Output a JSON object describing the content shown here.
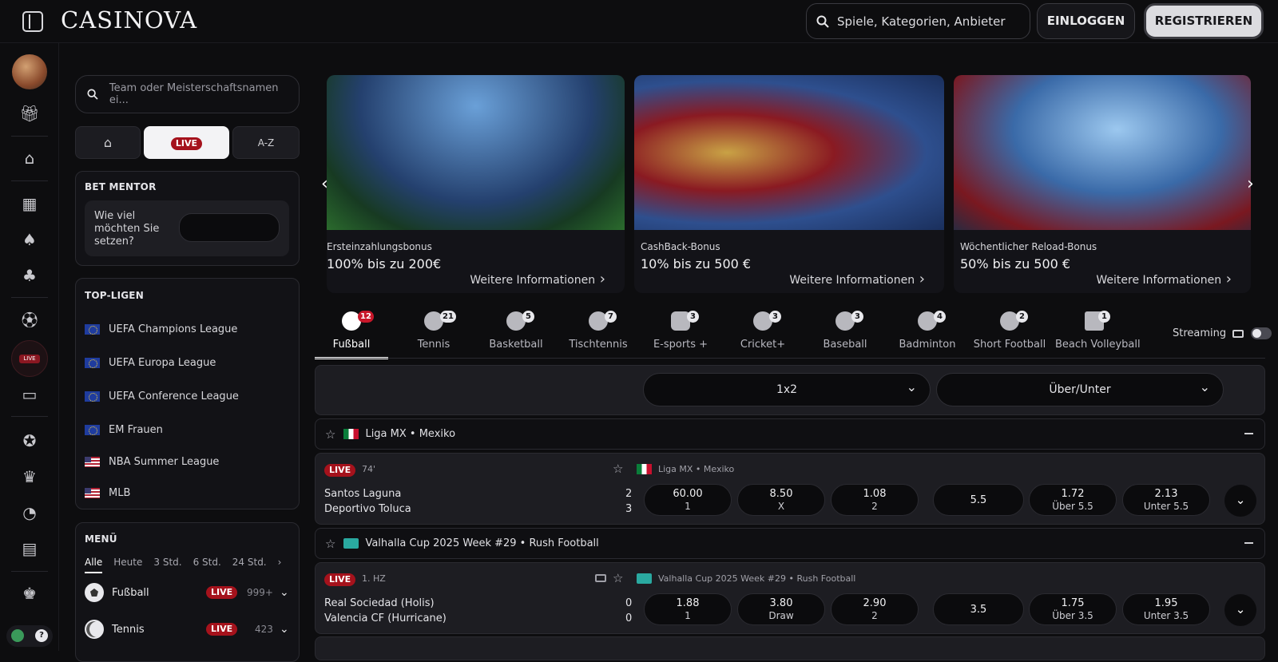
{
  "header": {
    "logo": "CASINOVA",
    "search_placeholder": "Spiele, Kategorien, Anbieter",
    "login": "EINLOGGEN",
    "register": "REGISTRIEREN"
  },
  "rail": {
    "icons": [
      "gift-icon",
      "home-icon",
      "slot-machine-icon",
      "cards-icon",
      "clover-icon",
      "soccer-icon",
      "live-icon",
      "tv-sport-icon",
      "settings-badge-icon",
      "trophy-icon",
      "pacman-icon",
      "shop-icon",
      "crown-icon"
    ],
    "live_label": "LIVE"
  },
  "sports_nav": {
    "search_placeholder": "Team oder Meisterschaftsnamen ei...",
    "seg_live": "LIVE",
    "seg_az": "A-Z",
    "bet_mentor": {
      "title": "BET MENTOR",
      "prompt": "Wie viel möchten Sie setzen?"
    },
    "top_leagues": {
      "title": "TOP-LIGEN",
      "items": [
        {
          "name": "UEFA Champions League",
          "flag": "eu"
        },
        {
          "name": "UEFA Europa League",
          "flag": "eu"
        },
        {
          "name": "UEFA Conference League",
          "flag": "eu"
        },
        {
          "name": "EM Frauen",
          "flag": "eu"
        },
        {
          "name": "NBA Summer League",
          "flag": "us"
        },
        {
          "name": "MLB",
          "flag": "us"
        }
      ]
    },
    "menu": {
      "title": "MENÜ",
      "tabs": [
        "Alle",
        "Heute",
        "3 Std.",
        "6 Std.",
        "24 Std."
      ],
      "sports": [
        {
          "name": "Fußball",
          "live": "LIVE",
          "count": "999+"
        },
        {
          "name": "Tennis",
          "live": "LIVE",
          "count": "423"
        }
      ]
    }
  },
  "banners": [
    {
      "title": "Ersteinzahlungsbonus",
      "offer": "100% bis zu 200€",
      "link": "Weitere Informationen"
    },
    {
      "title": "CashBack-Bonus",
      "offer": "10% bis zu 500 €",
      "link": "Weitere Informationen"
    },
    {
      "title": "Wöchentlicher Reload-Bonus",
      "offer": "50% bis zu 500 €",
      "link": "Weitere Informationen"
    }
  ],
  "sport_tabs": [
    {
      "label": "Fußball",
      "count": "12"
    },
    {
      "label": "Tennis",
      "count": "21"
    },
    {
      "label": "Basketball",
      "count": "5"
    },
    {
      "label": "Tischtennis",
      "count": "7"
    },
    {
      "label": "E-sports +",
      "count": "3"
    },
    {
      "label": "Cricket+",
      "count": "3"
    },
    {
      "label": "Baseball",
      "count": "3"
    },
    {
      "label": "Badminton",
      "count": "4"
    },
    {
      "label": "Short Football",
      "count": "2"
    },
    {
      "label": "Beach Volleyball",
      "count": "1"
    }
  ],
  "streaming": "Streaming",
  "markets": {
    "m1": "1x2",
    "m2": "Über/Unter"
  },
  "leagues": [
    {
      "name": "Liga MX • Mexiko"
    },
    {
      "name": "Valhalla Cup 2025 Week #29 • Rush Football"
    }
  ],
  "matches": [
    {
      "live": "LIVE",
      "time": "74'",
      "league": "Liga MX • Mexiko",
      "home": "Santos Laguna",
      "away": "Deportivo Toluca",
      "home_score": "2",
      "away_score": "3",
      "o1": "60.00",
      "k1": "1",
      "o2": "8.50",
      "k2": "X",
      "o3": "1.08",
      "k3": "2",
      "line": "5.5",
      "o4": "1.72",
      "k4": "Über 5.5",
      "o5": "2.13",
      "k5": "Unter 5.5"
    },
    {
      "live": "LIVE",
      "time": "1. HZ",
      "league": "Valhalla Cup 2025 Week #29 • Rush Football",
      "home": "Real Sociedad (Holis)",
      "away": "Valencia CF (Hurricane)",
      "home_score": "0",
      "away_score": "0",
      "o1": "1.88",
      "k1": "1",
      "o2": "3.80",
      "k2": "Draw",
      "o3": "2.90",
      "k3": "2",
      "line": "3.5",
      "o4": "1.75",
      "k4": "Über 3.5",
      "o5": "1.95",
      "k5": "Unter 3.5"
    }
  ]
}
